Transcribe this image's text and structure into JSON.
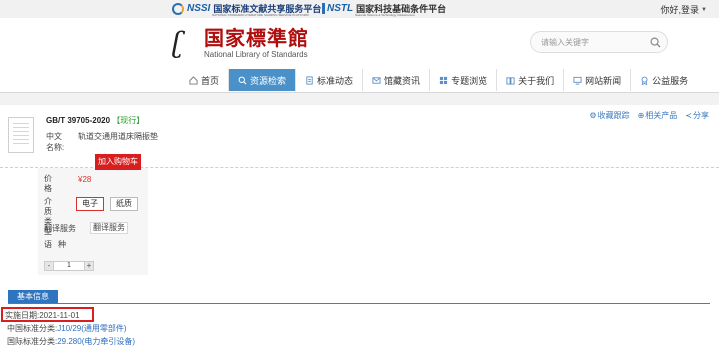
{
  "topbar": {
    "nssi_logo_text": "NSSI",
    "nssi_name": "国家标准文献共享服务平台",
    "nssi_name_en": "NATIONAL STANDARD LITERATURE SHARING SERVICE PLATFORM",
    "nstl_logo_text": "NSTL",
    "nstl_name": "国家科技基础条件平台",
    "nstl_name_en": "National Science & Technology Infrastructure",
    "login_label": "你好,登录"
  },
  "header": {
    "library_name_cn": "国家標準館",
    "library_name_en": "National Library of Standards",
    "search_placeholder": "请输入关键字"
  },
  "nav": {
    "items": [
      {
        "label": "首页",
        "icon": "home-icon"
      },
      {
        "label": "资源检索",
        "icon": "search-icon",
        "active": true
      },
      {
        "label": "标准动态",
        "icon": "doc-icon"
      },
      {
        "label": "馆藏资讯",
        "icon": "mail-icon"
      },
      {
        "label": "专题浏览",
        "icon": "grid-icon"
      },
      {
        "label": "关于我们",
        "icon": "book-icon"
      },
      {
        "label": "网站新闻",
        "icon": "monitor-icon"
      },
      {
        "label": "公益服务",
        "icon": "ribbon-icon"
      }
    ]
  },
  "product": {
    "code": "GB/T 39705-2020",
    "status": "【现行】",
    "cn_name_label": "中文名称:",
    "cn_name_value": "轨道交通用道床隔振垫",
    "actions": {
      "favorite": "收藏跟踪",
      "related": "相关产品",
      "share": "分享"
    },
    "price_label": "价格",
    "price_value": "¥28",
    "medium_label": "介质类型",
    "medium_options": [
      "电子",
      "纸质"
    ],
    "medium_selected": "电子",
    "translation_label": "翻译服务",
    "translation_value": "翻译服务",
    "language_label": "语种",
    "quantity": "1",
    "qty_minus": "-",
    "qty_plus": "+",
    "add_to_cart": "加入购物车"
  },
  "basic_info": {
    "tab_label": "基本信息",
    "implementation_date": "实施日期:2021-11-01",
    "ccs_label": "中国标准分类:",
    "ccs_value": "J10/29(通用零部件)",
    "ics_label": "国际标准分类:",
    "ics_value": "29.280(电力牵引设备)"
  },
  "colors": {
    "brand_red": "#b00d0d",
    "nav_active": "#4a90c9",
    "price_red": "#e0302e",
    "cart_red": "#d81e1e",
    "status_green": "#2f9e2f",
    "link_blue": "#2d6ec0",
    "tab_blue": "#2f74be"
  }
}
